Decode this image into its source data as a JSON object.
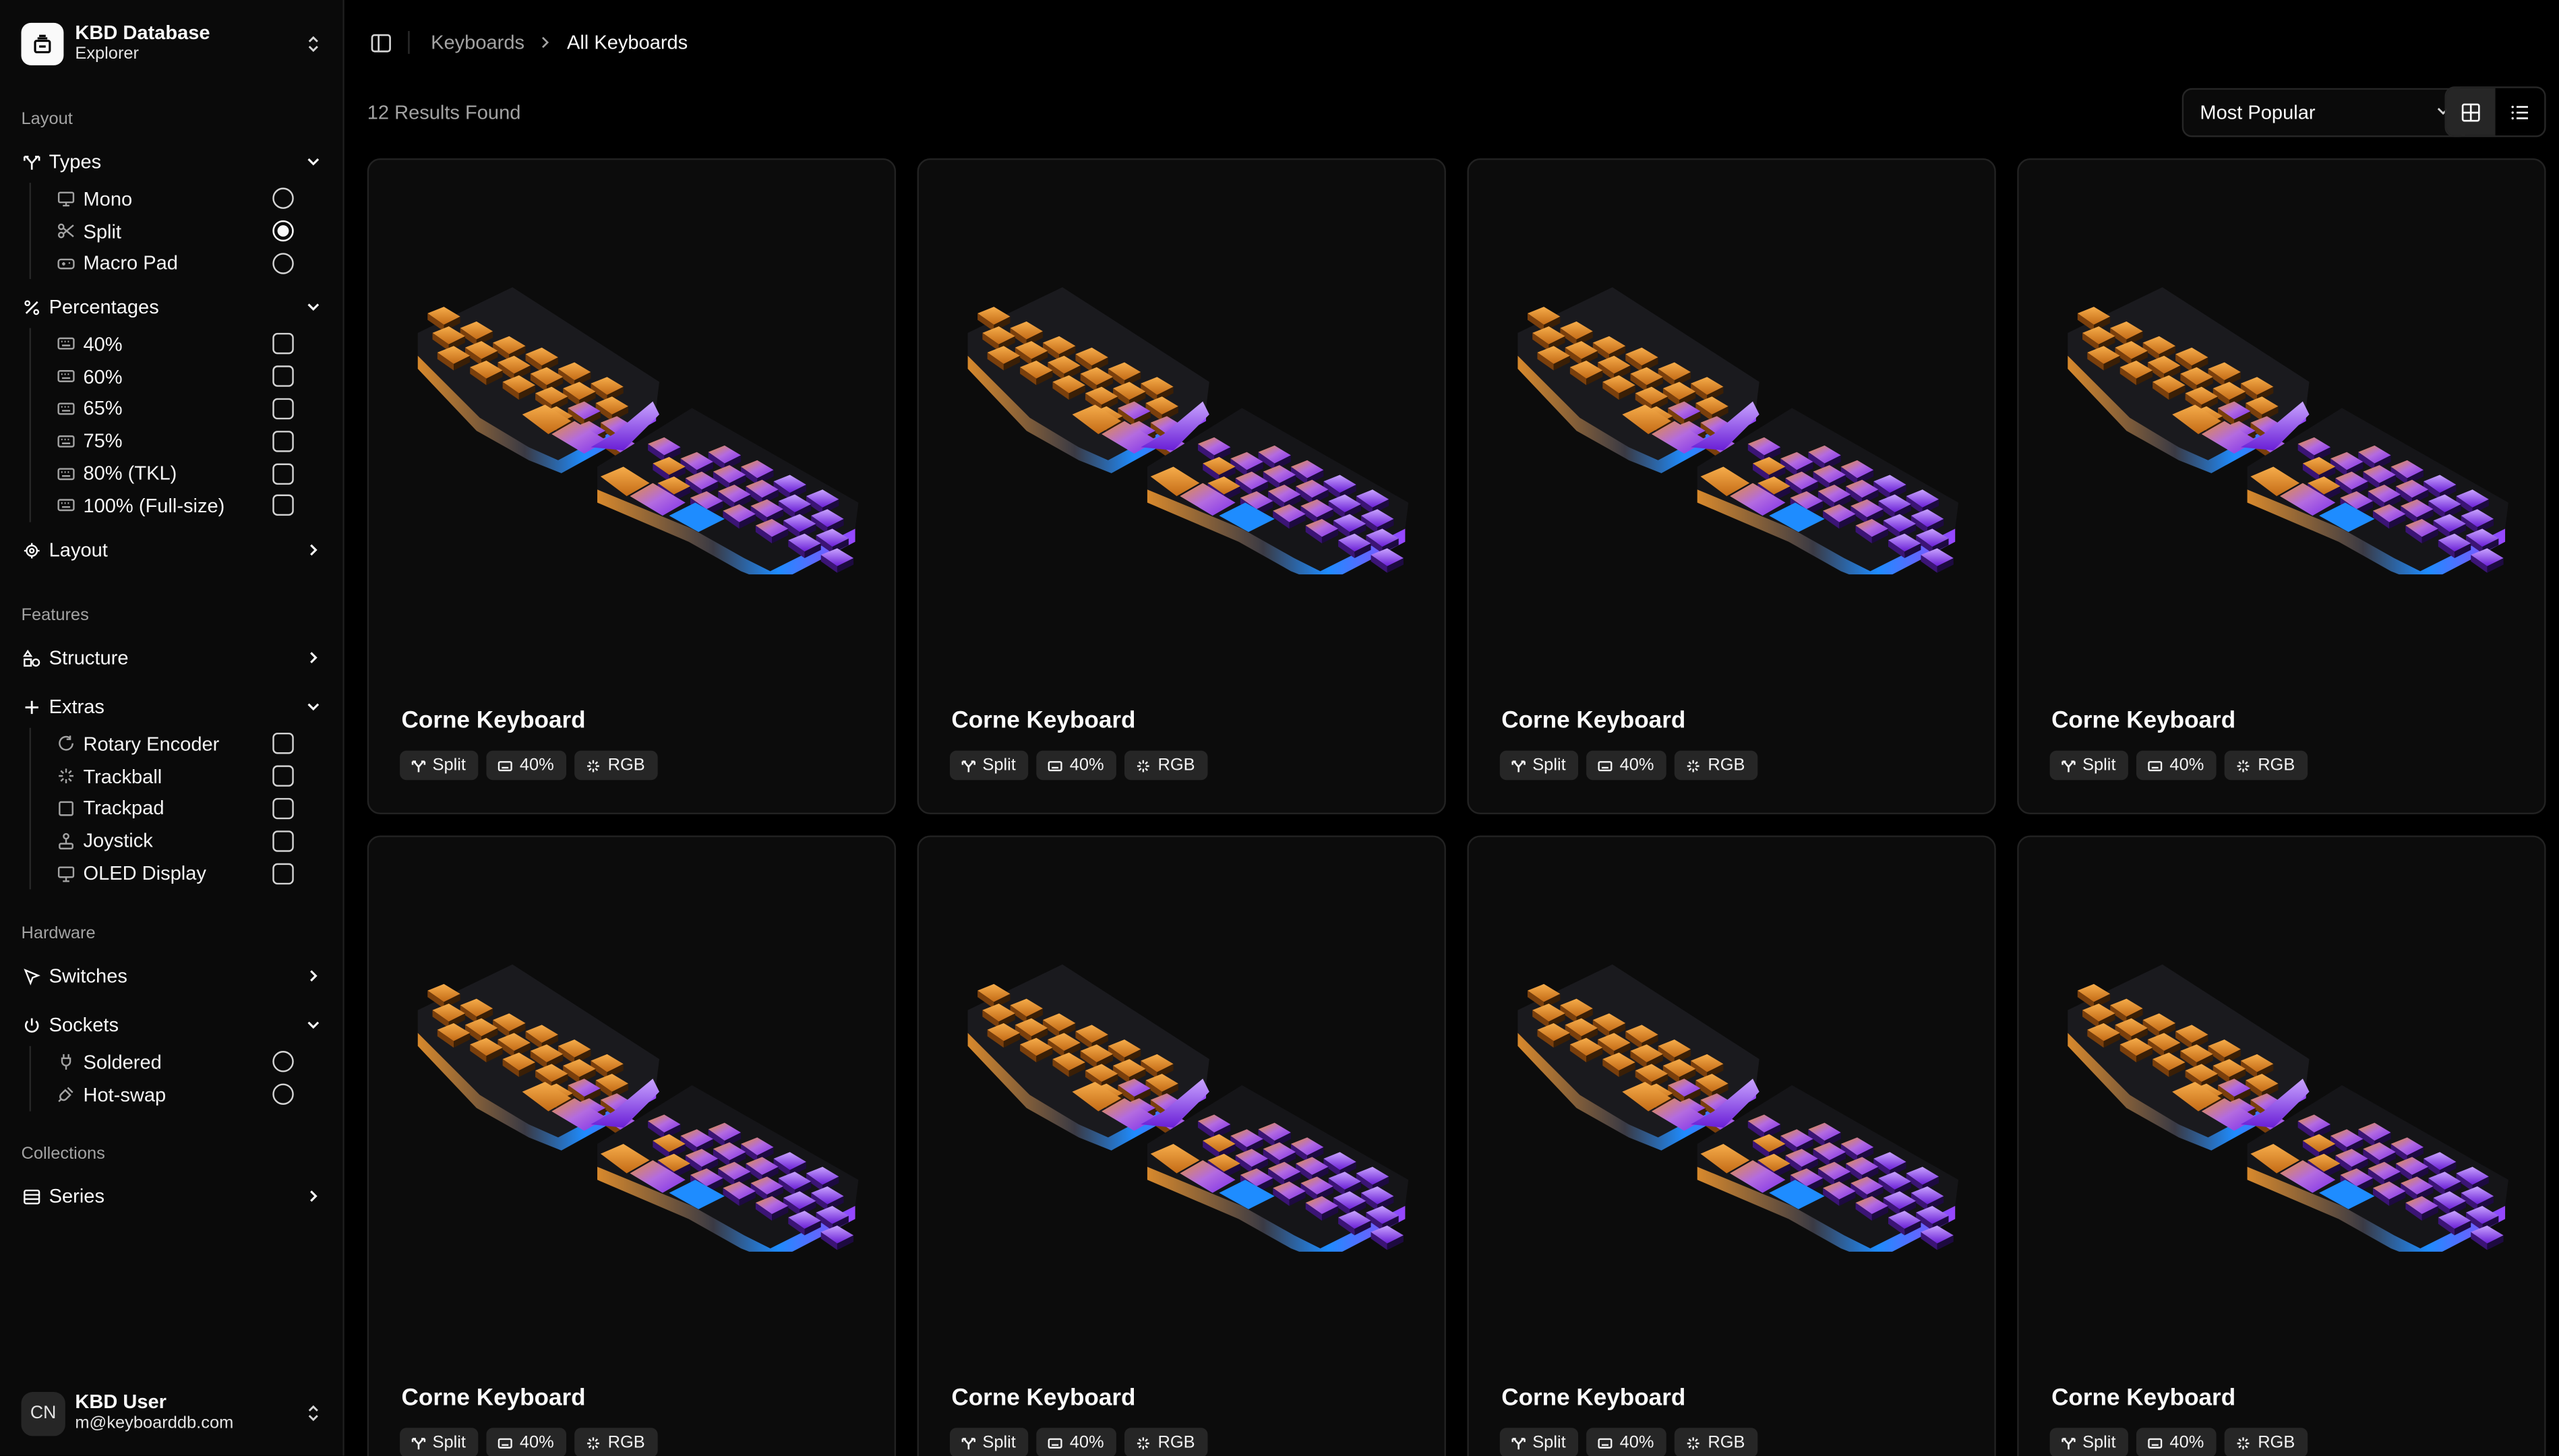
{
  "app": {
    "title": "KBD Database",
    "subtitle": "Explorer"
  },
  "sidebar": {
    "groups": {
      "layout": "Layout",
      "features": "Features",
      "hardware": "Hardware",
      "collections": "Collections"
    },
    "types": {
      "label": "Types",
      "items": [
        "Mono",
        "Split",
        "Macro Pad"
      ],
      "selected": "Split"
    },
    "percentages": {
      "label": "Percentages",
      "items": [
        "40%",
        "60%",
        "65%",
        "75%",
        "80% (TKL)",
        "100% (Full-size)"
      ]
    },
    "layout_item": "Layout",
    "structure": "Structure",
    "extras": {
      "label": "Extras",
      "items": [
        "Rotary Encoder",
        "Trackball",
        "Trackpad",
        "Joystick",
        "OLED Display"
      ]
    },
    "switches": "Switches",
    "sockets": {
      "label": "Sockets",
      "items": [
        "Soldered",
        "Hot-swap"
      ]
    },
    "series": "Series"
  },
  "user": {
    "initials": "CN",
    "name": "KBD User",
    "email": "m@keyboarddb.com"
  },
  "breadcrumb": {
    "parent": "Keyboards",
    "current": "All Keyboards"
  },
  "results_text": "12 Results Found",
  "sort": {
    "value": "Most Popular"
  },
  "cards": [
    {
      "title": "Corne Keyboard",
      "tags": [
        "Split",
        "40%",
        "RGB"
      ]
    },
    {
      "title": "Corne Keyboard",
      "tags": [
        "Split",
        "40%",
        "RGB"
      ]
    },
    {
      "title": "Corne Keyboard",
      "tags": [
        "Split",
        "40%",
        "RGB"
      ]
    },
    {
      "title": "Corne Keyboard",
      "tags": [
        "Split",
        "40%",
        "RGB"
      ]
    },
    {
      "title": "Corne Keyboard",
      "tags": [
        "Split",
        "40%",
        "RGB"
      ]
    },
    {
      "title": "Corne Keyboard",
      "tags": [
        "Split",
        "40%",
        "RGB"
      ]
    },
    {
      "title": "Corne Keyboard",
      "tags": [
        "Split",
        "40%",
        "RGB"
      ]
    },
    {
      "title": "Corne Keyboard",
      "tags": [
        "Split",
        "40%",
        "RGB"
      ]
    }
  ],
  "colors": {
    "keycap_orange": "#e8912f",
    "keycap_purple": "#8b3cf0",
    "accent_blue": "#1e8cff",
    "background": "#000000",
    "sidebar": "#0a0a0a"
  }
}
